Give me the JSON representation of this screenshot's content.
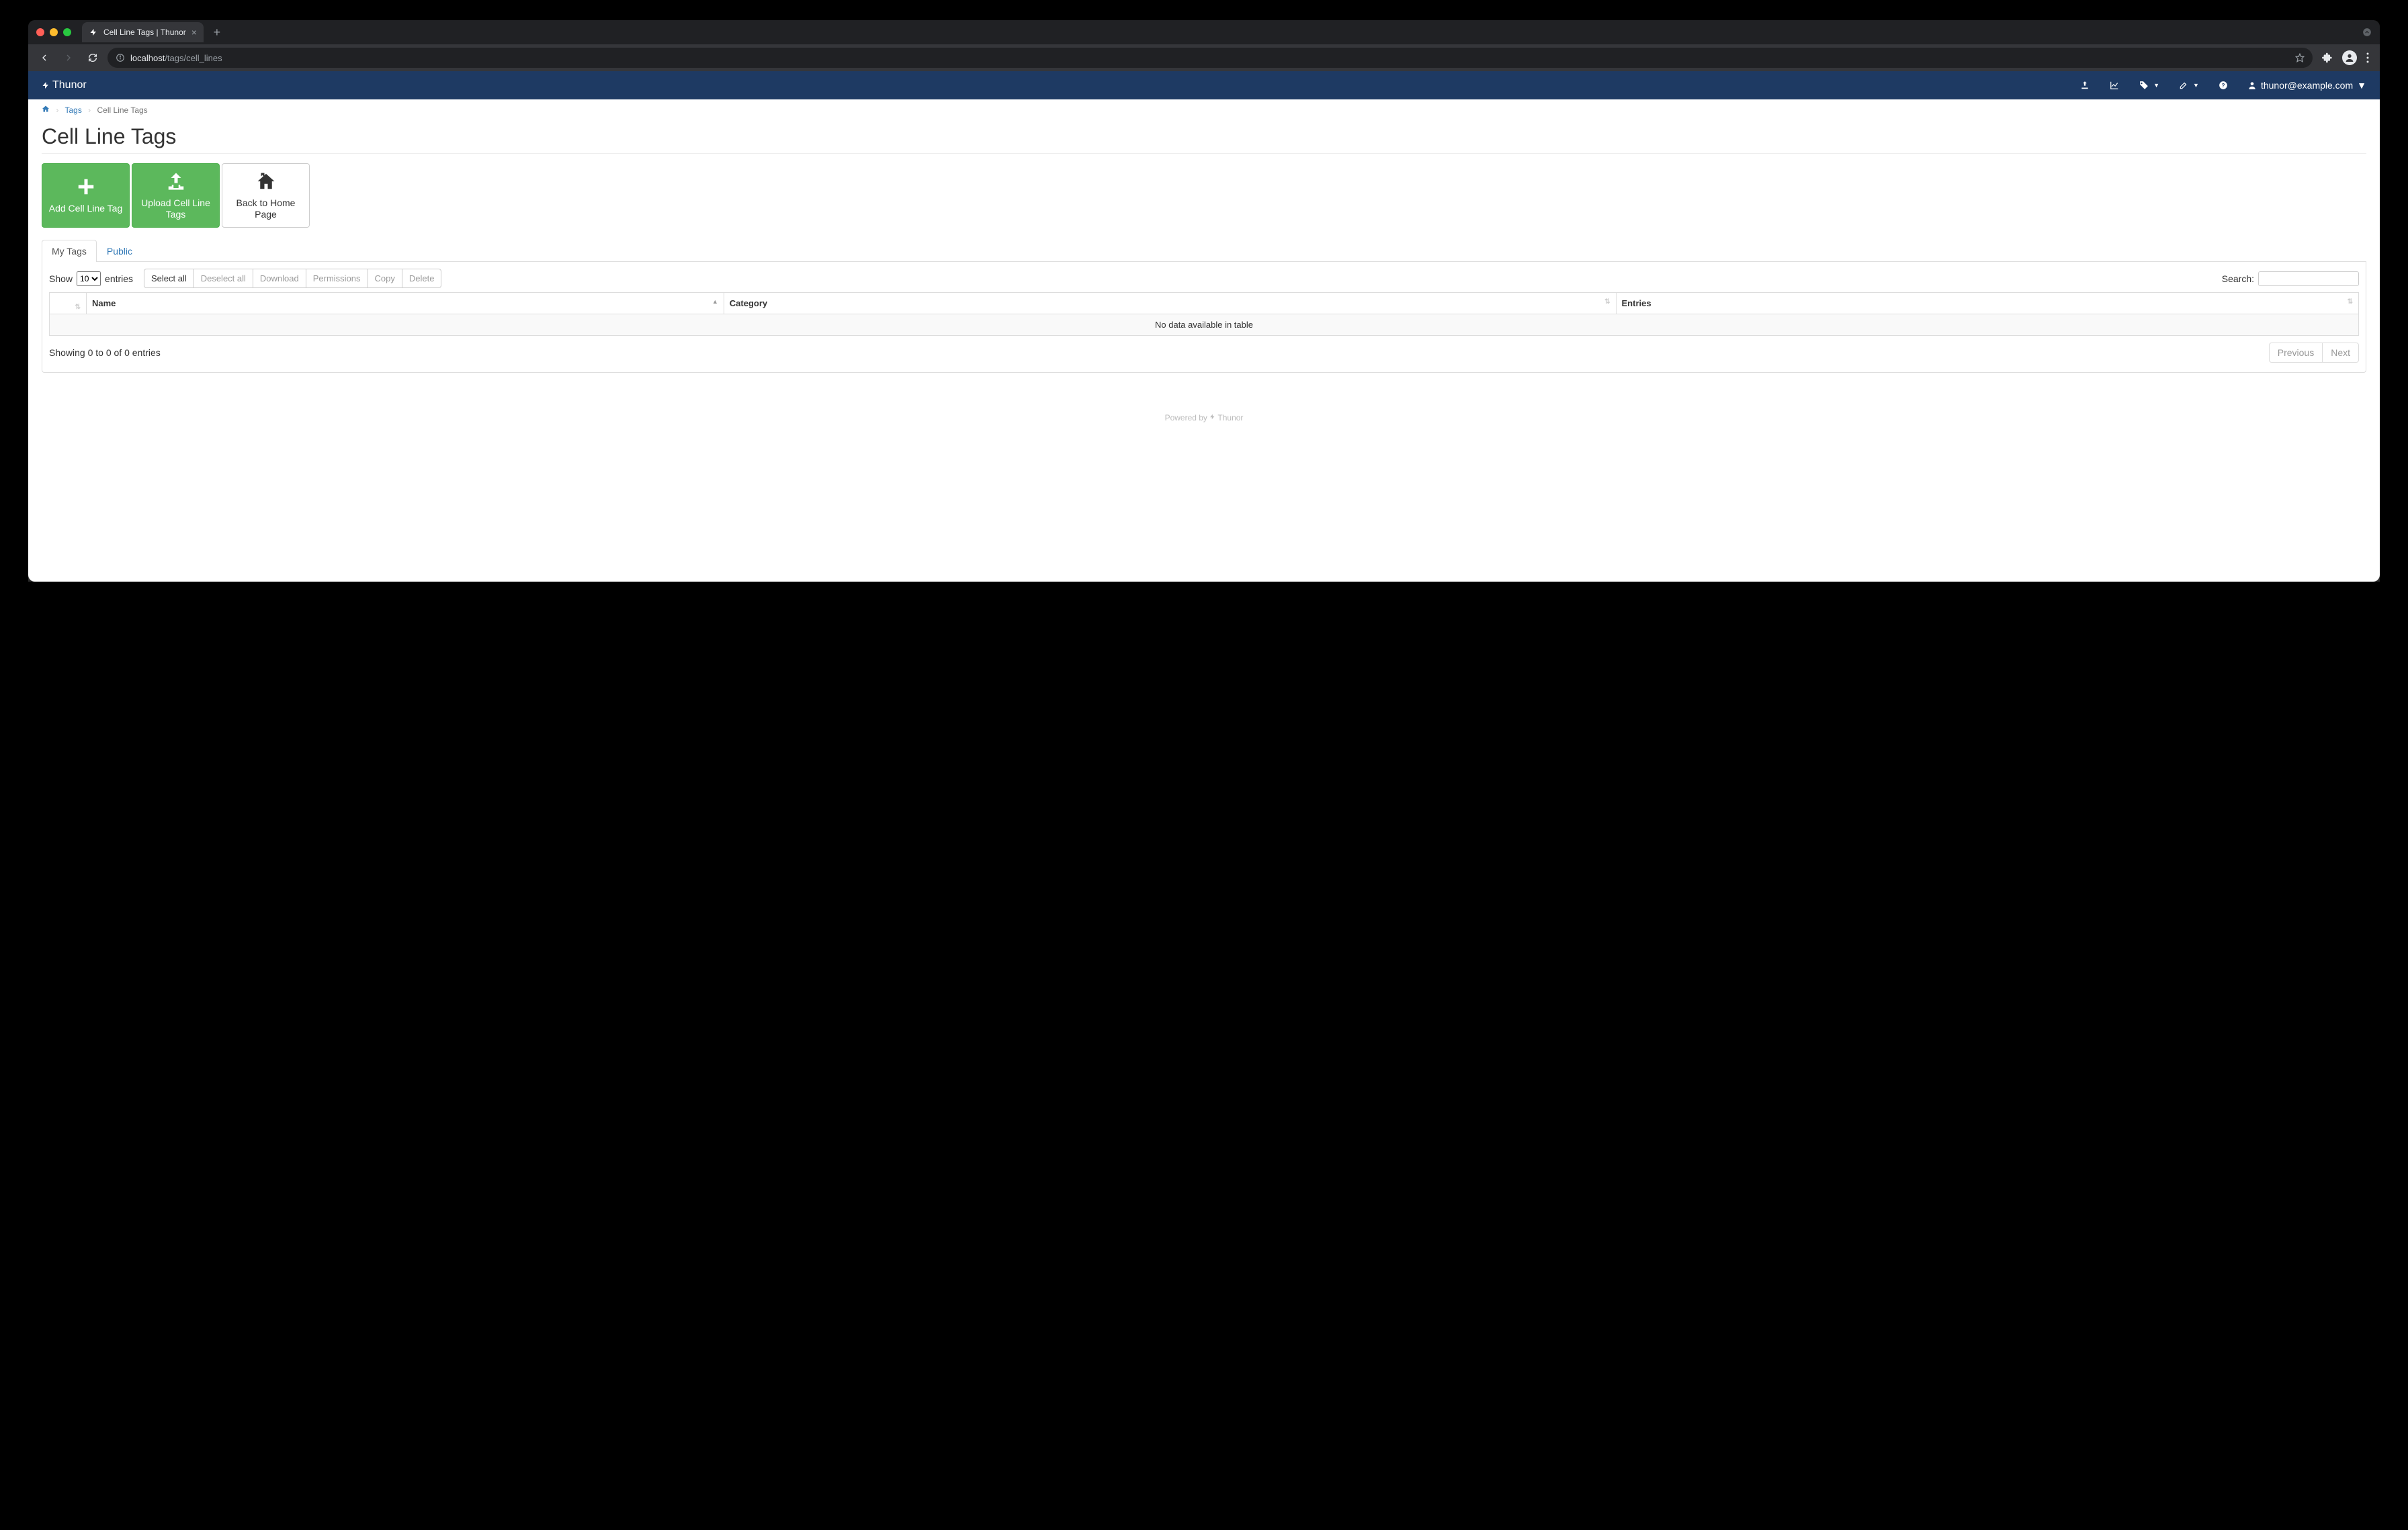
{
  "browser": {
    "tab_title": "Cell Line Tags | Thunor",
    "url_host": "localhost",
    "url_path": "/tags/cell_lines"
  },
  "navbar": {
    "brand": "Thunor",
    "user_email": "thunor@example.com"
  },
  "breadcrumb": {
    "tags_label": "Tags",
    "current": "Cell Line Tags"
  },
  "page": {
    "title": "Cell Line Tags",
    "actions": {
      "add": "Add Cell Line Tag",
      "upload": "Upload Cell Line Tags",
      "home": "Back to Home Page"
    },
    "tabs": {
      "my_tags": "My Tags",
      "public": "Public"
    }
  },
  "datatable": {
    "show_label": "Show",
    "entries_label": "entries",
    "length_value": "10",
    "buttons": {
      "select_all": "Select all",
      "deselect_all": "Deselect all",
      "download": "Download",
      "permissions": "Permissions",
      "copy": "Copy",
      "delete": "Delete"
    },
    "search_label": "Search:",
    "columns": {
      "name": "Name",
      "category": "Category",
      "entries": "Entries"
    },
    "empty_text": "No data available in table",
    "info_text": "Showing 0 to 0 of 0 entries",
    "paginate": {
      "previous": "Previous",
      "next": "Next"
    }
  },
  "footer": {
    "powered_by": "Powered by ",
    "brand": "Thunor"
  }
}
